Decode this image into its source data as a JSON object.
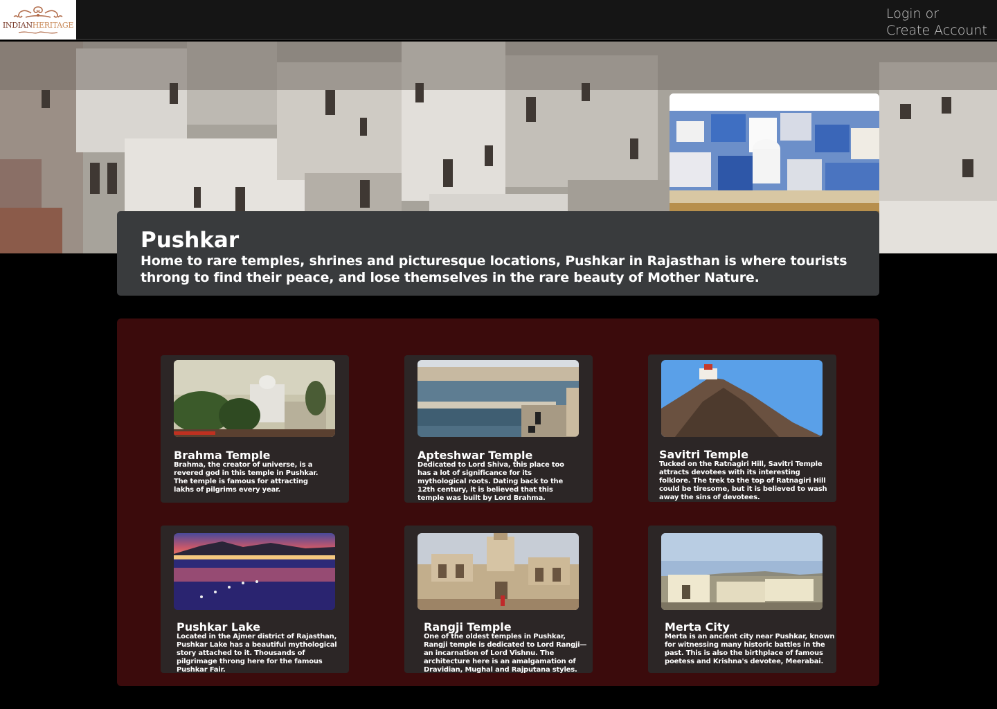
{
  "header": {
    "logo": {
      "word1": "INDIAN",
      "word2": "HERITAGE"
    },
    "auth": {
      "line1": "Login or",
      "line2": "Create Account"
    }
  },
  "intro": {
    "title": "Pushkar",
    "description": "Home to rare temples, shrines and picturesque locations, Pushkar in Rajasthan is where tourists throng to find their peace, and lose themselves in the rare beauty of Mother Nature."
  },
  "places": [
    {
      "title": "Brahma Temple",
      "text": "Brahma, the creator of universe, is a revered god in this temple in Pushkar. The temple is famous for attracting lakhs of pilgrims every year."
    },
    {
      "title": "Apteshwar Temple",
      "text": "Dedicated to Lord Shiva, this place too has a lot of significance for its mythological roots. Dating back to the 12th century, it is believed that this temple was built by Lord Brahma."
    },
    {
      "title": "Savitri Temple",
      "text": "Tucked on the Ratnagiri Hill, Savitri Temple attracts devotees with its interesting folklore. The trek to the top of Ratnagiri Hill could be tiresome, but it is believed to wash away the sins of devotees."
    },
    {
      "title": "Pushkar Lake",
      "text": "Located in the Ajmer district of Rajasthan, Pushkar Lake has a beautiful mythological story attached to it. Thousands of pilgrimage throng here for the famous Pushkar Fair."
    },
    {
      "title": "Rangji Temple",
      "text": "One of the oldest temples in Pushkar, Rangji temple is dedicated to Lord Rangji—an incarnation of Lord Vishnu. The architecture here is an amalgamation of Dravidian, Mughal and Rajputana styles."
    },
    {
      "title": "Merta City",
      "text": "Merta is an ancient city near Pushkar, known for witnessing many historic battles in the past. This is also the birthplace of famous poetess and Krishna's devotee, Meerabai."
    }
  ],
  "colors": {
    "topbar": "#151515",
    "intro_bg": "#393b3d",
    "panel_bg": "#3b0b0c",
    "card_bg": "#2c2626",
    "logo_primary": "#7a3b2a",
    "logo_accent": "#c98b5a"
  }
}
